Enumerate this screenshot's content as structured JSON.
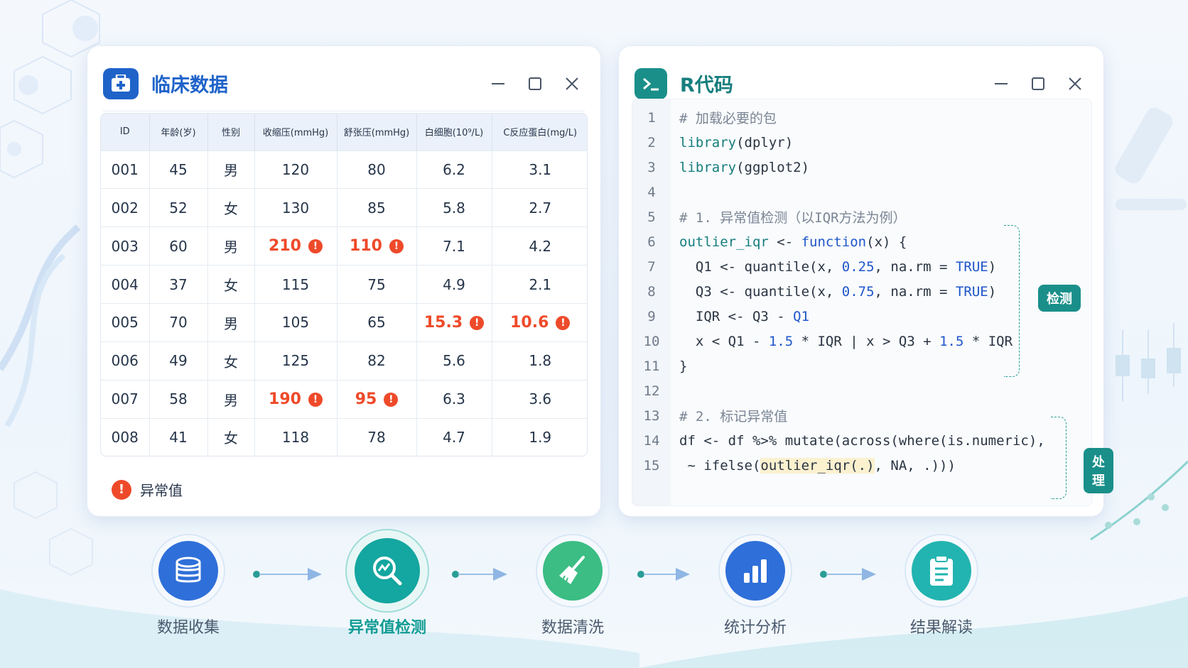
{
  "data_window": {
    "title": "临床数据",
    "columns": [
      "ID",
      "年龄(岁)",
      "性别",
      "收缩压(mmHg)",
      "舒张压(mmHg)",
      "白细胞(10⁹/L)",
      "C反应蛋白(mg/L)"
    ],
    "rows": [
      [
        "001",
        "45",
        "男",
        "120",
        "80",
        "6.2",
        "3.1"
      ],
      [
        "002",
        "52",
        "女",
        "130",
        "85",
        "5.8",
        "2.7"
      ],
      [
        "003",
        "60",
        "男",
        "210",
        "110",
        "7.1",
        "4.2"
      ],
      [
        "004",
        "37",
        "女",
        "115",
        "75",
        "4.9",
        "2.1"
      ],
      [
        "005",
        "70",
        "男",
        "105",
        "65",
        "15.3",
        "10.6"
      ],
      [
        "006",
        "49",
        "女",
        "125",
        "82",
        "5.6",
        "1.8"
      ],
      [
        "007",
        "58",
        "男",
        "190",
        "95",
        "6.3",
        "3.6"
      ],
      [
        "008",
        "41",
        "女",
        "118",
        "78",
        "4.7",
        "1.9"
      ]
    ],
    "outlier_flags": [
      [
        false,
        false,
        false,
        false,
        false,
        false,
        false
      ],
      [
        false,
        false,
        false,
        false,
        false,
        false,
        false
      ],
      [
        false,
        false,
        false,
        true,
        true,
        false,
        false
      ],
      [
        false,
        false,
        false,
        false,
        false,
        false,
        false
      ],
      [
        false,
        false,
        false,
        false,
        false,
        true,
        true
      ],
      [
        false,
        false,
        false,
        false,
        false,
        false,
        false
      ],
      [
        false,
        false,
        false,
        true,
        true,
        false,
        false
      ],
      [
        false,
        false,
        false,
        false,
        false,
        false,
        false
      ]
    ],
    "warn_glyph": "!",
    "legend_label": "异常值"
  },
  "code_window": {
    "title": "R代码",
    "lines": [
      {
        "n": "1",
        "html": "<span class=\"cm\"># 加载必要的包</span>"
      },
      {
        "n": "2",
        "html": "<span class=\"fn\">library</span>(dplyr)"
      },
      {
        "n": "3",
        "html": "<span class=\"fn\">library</span>(ggplot2)"
      },
      {
        "n": "4",
        "html": ""
      },
      {
        "n": "5",
        "html": "<span class=\"cm\"># 1. 异常值检测（以IQR方法为例）</span>"
      },
      {
        "n": "6",
        "html": "<span class=\"fn\">outlier_iqr</span> &lt;- <span class=\"kw\">function</span>(x) {"
      },
      {
        "n": "7",
        "html": "  Q1 &lt;- quantile(x, <span class=\"num\">0.25</span>, na.rm = <span class=\"kw\">TRUE</span>)"
      },
      {
        "n": "8",
        "html": "  Q3 &lt;- quantile(x, <span class=\"num\">0.75</span>, na.rm = <span class=\"kw\">TRUE</span>)"
      },
      {
        "n": "9",
        "html": "  IQR &lt;- Q3 - <span class=\"kw\">Q1</span>"
      },
      {
        "n": "10",
        "html": "  x &lt; Q1 - <span class=\"num\">1.5</span> * IQR | x &gt; Q3 + <span class=\"num\">1.5</span> * IQR"
      },
      {
        "n": "11",
        "html": "}"
      },
      {
        "n": "12",
        "html": ""
      },
      {
        "n": "13",
        "html": "<span class=\"cm\"># 2. 标记异常值</span>"
      },
      {
        "n": "14",
        "html": "df &lt;- df %&gt;% mutate(across(where(is.numeric),"
      },
      {
        "n": "15",
        "html": " ~ ifelse(<span class=\"hl\">outlier_iqr(.)</span>, NA, .)))"
      }
    ],
    "tag_detect": "检测",
    "tag_process": "处理"
  },
  "pipeline": {
    "steps": [
      {
        "label": "数据收集",
        "icon": "database-icon",
        "color": "#2f6fd9"
      },
      {
        "label": "异常值检测",
        "icon": "search-chart-icon",
        "color": "#14a6a0"
      },
      {
        "label": "数据清洗",
        "icon": "broom-icon",
        "color": "#3bbd84"
      },
      {
        "label": "统计分析",
        "icon": "bar-chart-icon",
        "color": "#2f6fd9"
      },
      {
        "label": "结果解读",
        "icon": "clipboard-icon",
        "color": "#22b4b0"
      }
    ],
    "active_index": 1
  },
  "colors": {
    "accent_blue": "#1f63c9",
    "accent_teal": "#167d7d",
    "outlier_red": "#ee4a2a"
  }
}
